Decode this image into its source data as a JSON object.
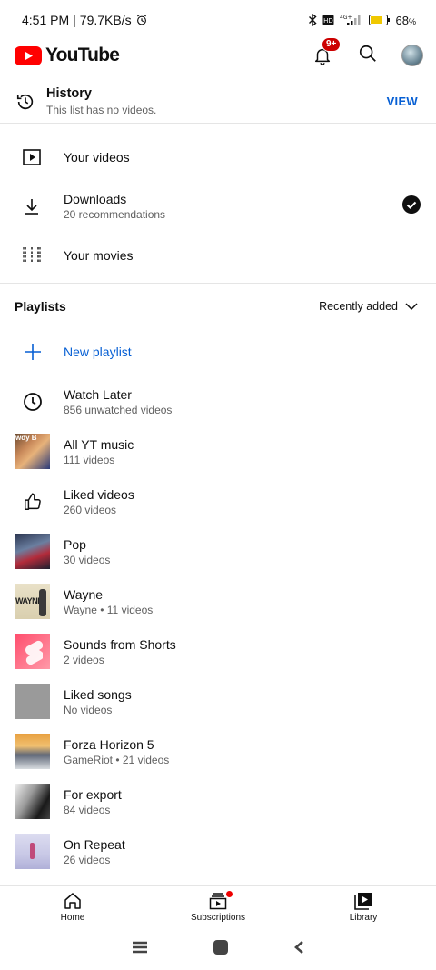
{
  "status_bar": {
    "time": "4:51 PM",
    "speed": "79.7KB/s",
    "battery": "68"
  },
  "header": {
    "logo_text": "YouTube",
    "notification_badge": "9+"
  },
  "history": {
    "title": "History",
    "subtitle": "This list has no videos.",
    "action": "VIEW"
  },
  "library": {
    "your_videos": {
      "title": "Your videos"
    },
    "downloads": {
      "title": "Downloads",
      "subtitle": "20 recommendations"
    },
    "your_movies": {
      "title": "Your movies"
    }
  },
  "playlists": {
    "heading": "Playlists",
    "sort_label": "Recently added",
    "new_playlist": "New playlist",
    "items": [
      {
        "title": "Watch Later",
        "subtitle": "856 unwatched videos",
        "thumb": "clock-icon"
      },
      {
        "title": "All YT music",
        "subtitle": "111 videos",
        "thumb": "image",
        "thumb_text": "wdy B"
      },
      {
        "title": "Liked videos",
        "subtitle": "260 videos",
        "thumb": "thumbs-up-icon"
      },
      {
        "title": "Pop",
        "subtitle": "30 videos",
        "thumb": "image"
      },
      {
        "title": "Wayne",
        "subtitle": "Wayne • 11 videos",
        "thumb": "image",
        "thumb_text": "WAYNE"
      },
      {
        "title": "Sounds from Shorts",
        "subtitle": "2 videos",
        "thumb": "image"
      },
      {
        "title": "Liked songs",
        "subtitle": "No videos",
        "thumb": "image"
      },
      {
        "title": "Forza Horizon 5",
        "subtitle": "GameRiot • 21 videos",
        "thumb": "image"
      },
      {
        "title": "For export",
        "subtitle": "84 videos",
        "thumb": "image"
      },
      {
        "title": "On Repeat",
        "subtitle": "26 videos",
        "thumb": "image"
      }
    ]
  },
  "bottom_nav": {
    "home": "Home",
    "subscriptions": "Subscriptions",
    "library": "Library"
  },
  "colors": {
    "brand_red": "#ff0000",
    "link_blue": "#065fd4",
    "text_primary": "#0f0f0f",
    "text_secondary": "#606060"
  }
}
